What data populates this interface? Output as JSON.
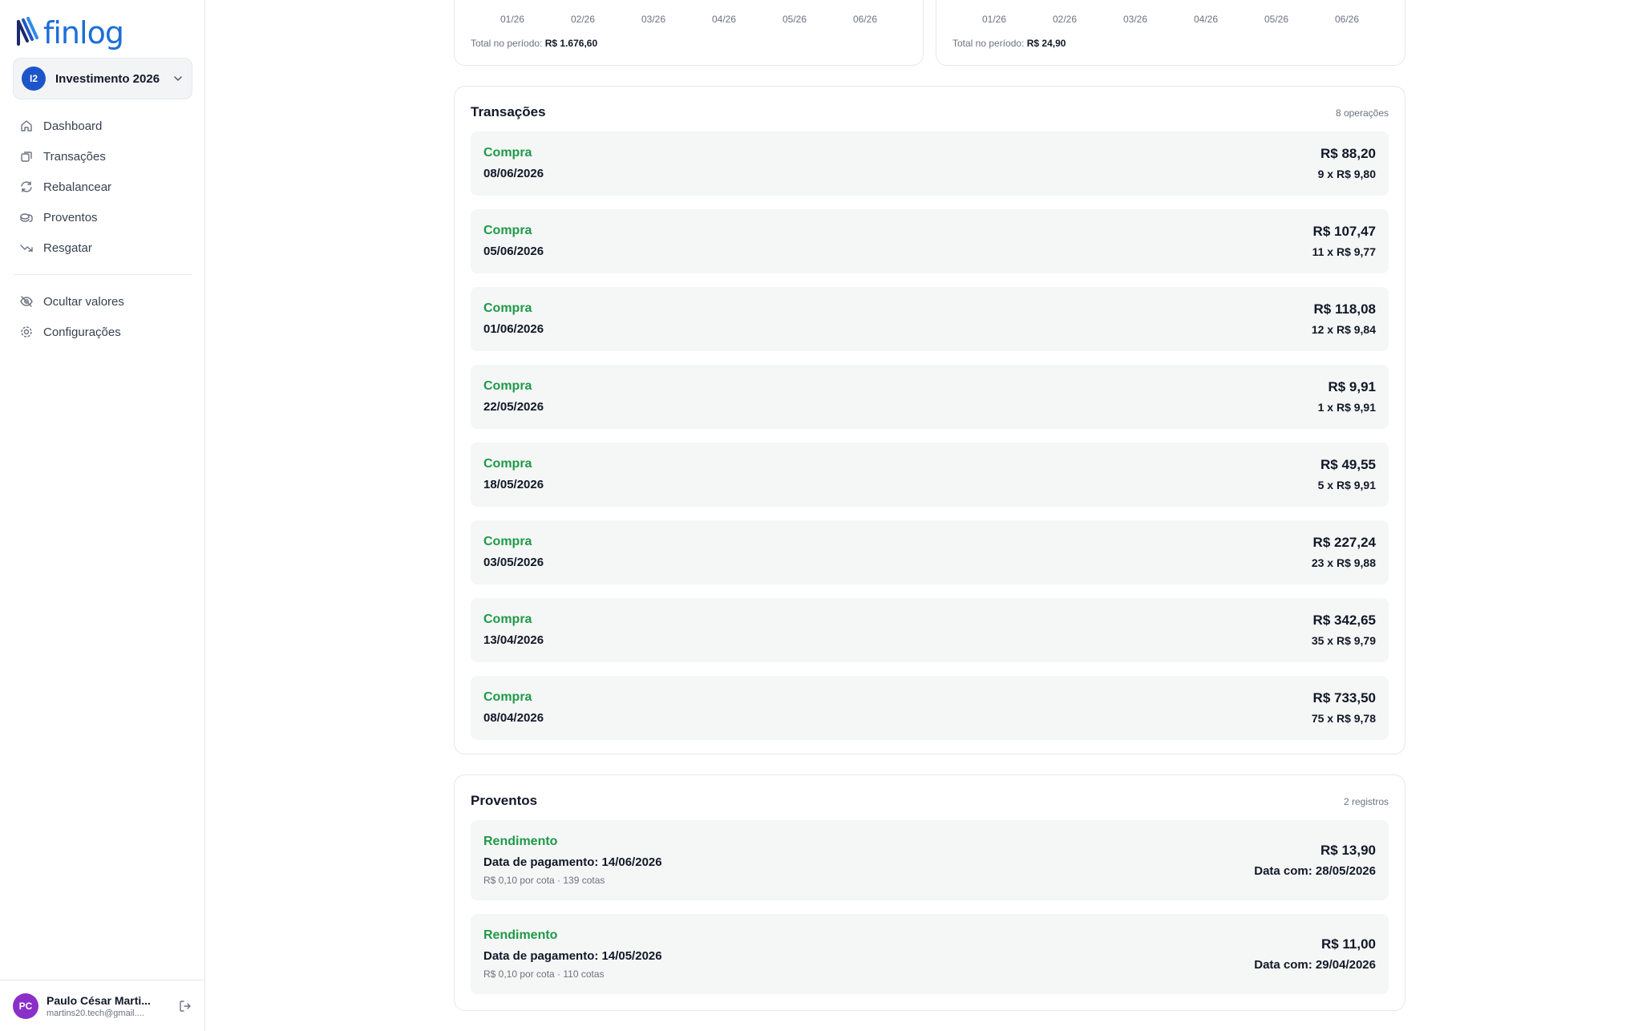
{
  "brand": {
    "name": "finlog",
    "color": "#1d6fd6"
  },
  "portfolio": {
    "initials": "I2",
    "name": "Investimento 2026"
  },
  "nav": {
    "primary": [
      {
        "label": "Dashboard",
        "icon": "home-icon"
      },
      {
        "label": "Transações",
        "icon": "transactions-icon"
      },
      {
        "label": "Rebalancear",
        "icon": "refresh-icon"
      },
      {
        "label": "Proventos",
        "icon": "coins-icon"
      },
      {
        "label": "Resgatar",
        "icon": "trending-down-icon"
      }
    ],
    "secondary": [
      {
        "label": "Ocultar valores",
        "icon": "eye-off-icon"
      },
      {
        "label": "Configurações",
        "icon": "gear-icon"
      }
    ]
  },
  "user": {
    "initials": "PC",
    "name": "Paulo César Marti...",
    "email": "martins20.tech@gmail...."
  },
  "charts": [
    {
      "months": [
        "01/26",
        "02/26",
        "03/26",
        "04/26",
        "05/26",
        "06/26"
      ],
      "total_label": "Total no período:",
      "total_value": "R$ 1.676,60"
    },
    {
      "months": [
        "01/26",
        "02/26",
        "03/26",
        "04/26",
        "05/26",
        "06/26"
      ],
      "total_label": "Total no período:",
      "total_value": "R$ 24,90"
    }
  ],
  "transactions": {
    "title": "Transações",
    "count": "8 operações",
    "items": [
      {
        "type": "Compra",
        "date": "08/06/2026",
        "amount": "R$ 88,20",
        "detail": "9 x R$ 9,80"
      },
      {
        "type": "Compra",
        "date": "05/06/2026",
        "amount": "R$ 107,47",
        "detail": "11 x R$ 9,77"
      },
      {
        "type": "Compra",
        "date": "01/06/2026",
        "amount": "R$ 118,08",
        "detail": "12 x R$ 9,84"
      },
      {
        "type": "Compra",
        "date": "22/05/2026",
        "amount": "R$ 9,91",
        "detail": "1 x R$ 9,91"
      },
      {
        "type": "Compra",
        "date": "18/05/2026",
        "amount": "R$ 49,55",
        "detail": "5 x R$ 9,91"
      },
      {
        "type": "Compra",
        "date": "03/05/2026",
        "amount": "R$ 227,24",
        "detail": "23 x R$ 9,88"
      },
      {
        "type": "Compra",
        "date": "13/04/2026",
        "amount": "R$ 342,65",
        "detail": "35 x R$ 9,79"
      },
      {
        "type": "Compra",
        "date": "08/04/2026",
        "amount": "R$ 733,50",
        "detail": "75 x R$ 9,78"
      }
    ]
  },
  "proventos": {
    "title": "Proventos",
    "count": "2 registros",
    "items": [
      {
        "type": "Rendimento",
        "payment": "Data de pagamento: 14/06/2026",
        "sub": "R$ 0,10 por cota · 139 cotas",
        "amount": "R$ 13,90",
        "datacom": "Data com: 28/05/2026"
      },
      {
        "type": "Rendimento",
        "payment": "Data de pagamento: 14/05/2026",
        "sub": "R$ 0,10 por cota · 110 cotas",
        "amount": "R$ 11,00",
        "datacom": "Data com: 29/04/2026"
      }
    ]
  },
  "colors": {
    "positive": "#1e9a48",
    "row_bg": "#f5f6f6",
    "portfolio_avatar": "#1d55c9",
    "user_avatar": "#8b2fc9"
  }
}
